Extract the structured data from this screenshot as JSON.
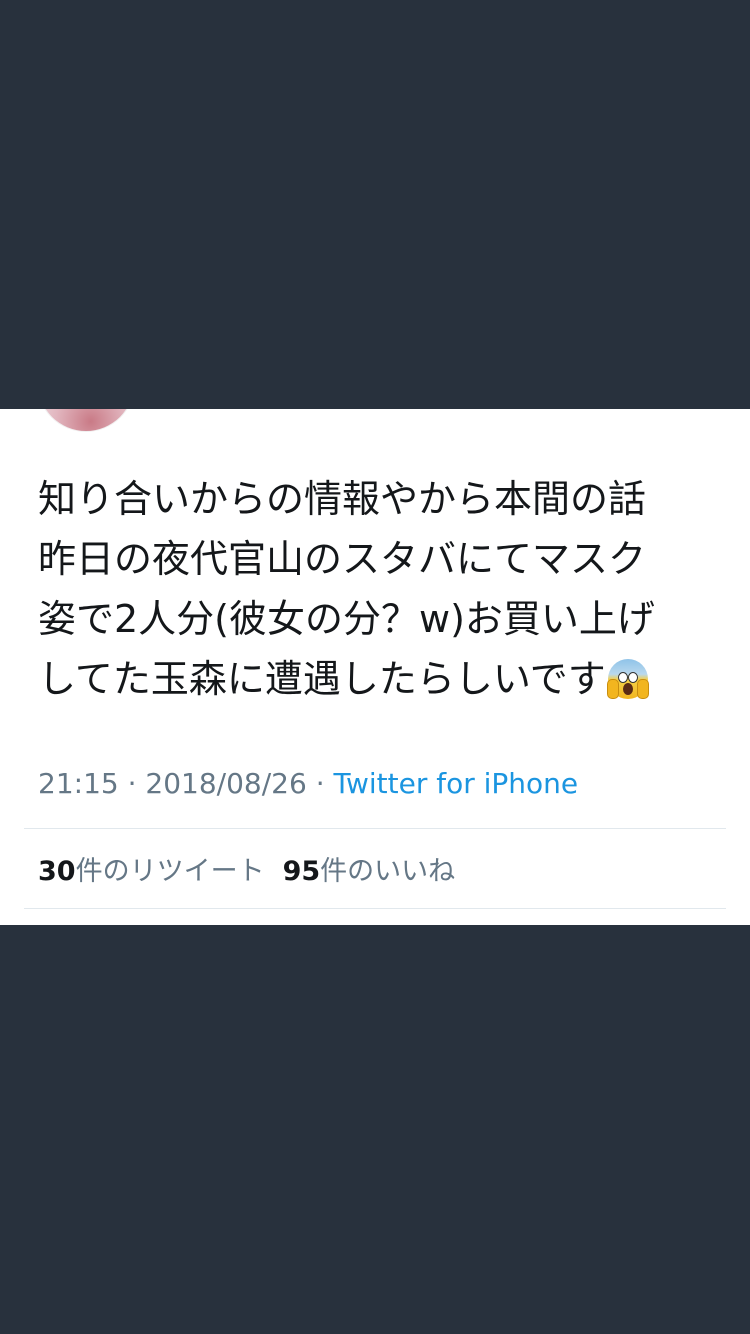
{
  "tweet": {
    "text": "知り合いからの情報やから本間の話\n昨日の夜代官山のスタバにてマスク\n姿で2人分(彼女の分？w)お買い上げ\nしてた玉森に遭遇したらしいです",
    "emoji": "face-screaming-in-fear",
    "time": "21:15",
    "separator": " · ",
    "date": "2018/08/26",
    "source": "Twitter for iPhone"
  },
  "stats": {
    "retweets": {
      "count": "30",
      "label": "件のリツイート"
    },
    "likes": {
      "count": "95",
      "label": "件のいいね"
    }
  },
  "colors": {
    "background": "#28313d",
    "card": "#ffffff",
    "text": "#14171a",
    "muted": "#657786",
    "link": "#1b95e0",
    "divider": "#e1e8ed"
  }
}
